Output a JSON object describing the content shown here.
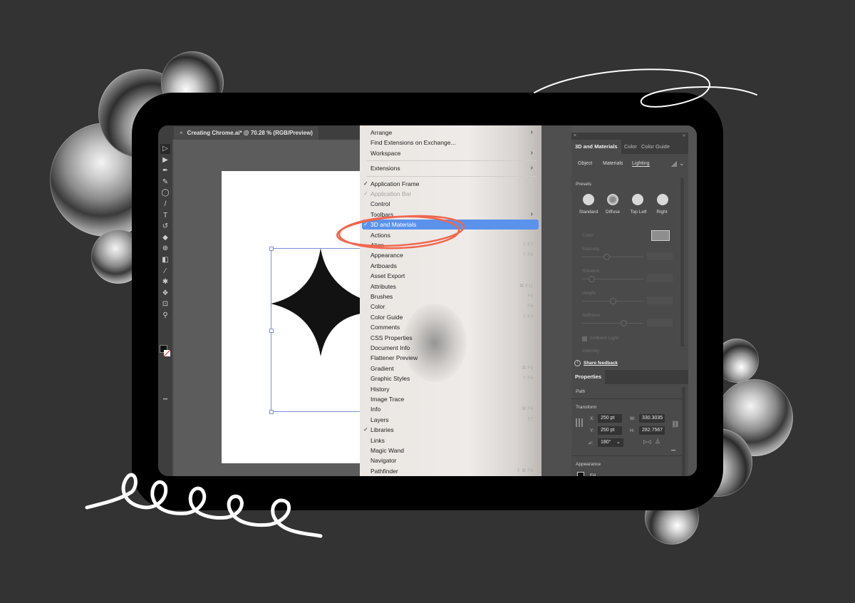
{
  "document_tab": {
    "close_glyph": "×",
    "title": "Creating Chrome.ai* @ 70.28 % (RGB/Preview)"
  },
  "toolbar": {
    "tools": [
      {
        "name": "selection-tool",
        "glyph": "▷"
      },
      {
        "name": "direct-selection-tool",
        "glyph": "▶"
      },
      {
        "name": "pen-tool",
        "glyph": "✒"
      },
      {
        "name": "curvature-tool",
        "glyph": "✎"
      },
      {
        "name": "ellipse-tool",
        "glyph": "◯"
      },
      {
        "name": "brush-tool",
        "glyph": "/"
      },
      {
        "name": "type-tool",
        "glyph": "T"
      },
      {
        "name": "rotate-tool",
        "glyph": "↺"
      },
      {
        "name": "eraser-tool",
        "glyph": "◆"
      },
      {
        "name": "shape-builder-tool",
        "glyph": "⊕"
      },
      {
        "name": "gradient-tool",
        "glyph": "◧"
      },
      {
        "name": "eyedropper-tool",
        "glyph": "⁄"
      },
      {
        "name": "puppet-warp-tool",
        "glyph": "✱"
      },
      {
        "name": "symbol-sprayer-tool",
        "glyph": "❖"
      },
      {
        "name": "artboard-tool",
        "glyph": "⊡"
      },
      {
        "name": "zoom-tool",
        "glyph": "⚲"
      }
    ],
    "more_glyph": "•••"
  },
  "window_menu": {
    "items": [
      {
        "label": "Arrange",
        "submenu": true
      },
      {
        "label": "Find Extensions on Exchange..."
      },
      {
        "label": "Workspace",
        "submenu": true
      },
      {
        "separator": true
      },
      {
        "label": "Extensions",
        "submenu": true
      },
      {
        "separator": true
      },
      {
        "label": "Application Frame",
        "checked": true
      },
      {
        "label": "Application Bar",
        "checked": true,
        "disabled": true
      },
      {
        "label": "Control"
      },
      {
        "label": "Toolbars",
        "submenu": true
      },
      {
        "label": "3D and Materials",
        "checked": true,
        "selected": true
      },
      {
        "label": "Actions"
      },
      {
        "label": "Align",
        "shortcut": "⇧ F7"
      },
      {
        "label": "Appearance",
        "shortcut": "⇧ F6"
      },
      {
        "label": "Artboards"
      },
      {
        "label": "Asset Export"
      },
      {
        "label": "Attributes",
        "shortcut": "⌘ F11"
      },
      {
        "label": "Brushes",
        "shortcut": "F5"
      },
      {
        "label": "Color",
        "shortcut": "F6"
      },
      {
        "label": "Color Guide",
        "shortcut": "⇧ F3"
      },
      {
        "label": "Comments"
      },
      {
        "label": "CSS Properties"
      },
      {
        "label": "Document Info"
      },
      {
        "label": "Flattener Preview"
      },
      {
        "label": "Gradient",
        "shortcut": "⌘ F9"
      },
      {
        "label": "Graphic Styles",
        "shortcut": "⇧ F5"
      },
      {
        "label": "History"
      },
      {
        "label": "Image Trace"
      },
      {
        "label": "Info",
        "shortcut": "⌘ F8"
      },
      {
        "label": "Layers",
        "shortcut": "F7"
      },
      {
        "label": "Libraries",
        "checked": true
      },
      {
        "label": "Links"
      },
      {
        "label": "Magic Wand"
      },
      {
        "label": "Navigator"
      },
      {
        "label": "Pathfinder",
        "shortcut": "⇧ ⌘ F9"
      }
    ],
    "check_glyph": "✓",
    "arrow_glyph": "›"
  },
  "materials_panel": {
    "close_glyph": "×",
    "collapse_glyph": "»",
    "tabs": [
      "3D and Materials",
      "Color",
      "Color Guide"
    ],
    "active_tab": "3D and Materials",
    "subtabs": [
      "Object",
      "Materials",
      "Lighting"
    ],
    "active_subtab": "Lighting",
    "presets_label": "Presets",
    "presets": [
      "Standard",
      "Diffuse",
      "Top Left",
      "Right"
    ],
    "color_label": "Color",
    "sliders": [
      {
        "label": "Intensity",
        "value_fraction": 0.4
      },
      {
        "label": "Rotation",
        "value_fraction": 0.15
      },
      {
        "label": "Height",
        "value_fraction": 0.5
      },
      {
        "label": "Softness",
        "value_fraction": 0.68
      }
    ],
    "ambient_light_label": "Ambient Light",
    "ambient_light_checked": true,
    "ambient_intensity_label": "Intensity",
    "share_feedback_label": "Share feedback",
    "info_glyph": "i"
  },
  "properties_panel": {
    "tab": "Properties",
    "object_type": "Path",
    "transform_label": "Transform",
    "x_label": "X:",
    "x_value": "250 pt",
    "y_label": "Y:",
    "y_value": "250 pt",
    "w_label": "W:",
    "w_value": "330.3035",
    "h_label": "H:",
    "h_value": "282.7567",
    "angle_label": "⊿:",
    "angle_value": "180°",
    "dropdown_glyph": "⌄",
    "more_glyph": "•••",
    "appearance_label": "Appearance",
    "fill_label": "Fill"
  },
  "colors": {
    "accent_highlight": "#5a92ec",
    "annotation_circle": "#f0674f",
    "background": "#333333"
  }
}
